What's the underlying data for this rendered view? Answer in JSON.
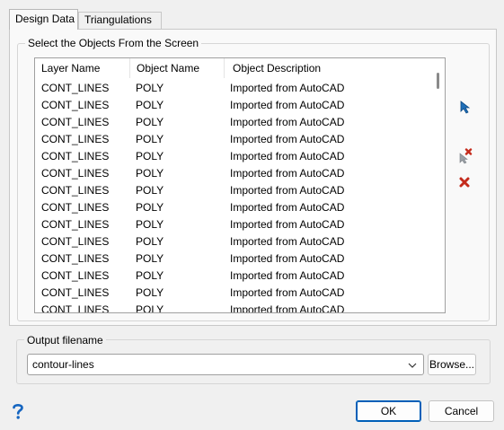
{
  "tabs": [
    {
      "label": "Design Data",
      "active": true
    },
    {
      "label": "Triangulations",
      "active": false
    }
  ],
  "objects_group": {
    "title": "Select the Objects From the Screen",
    "columns": [
      "Layer Name",
      "Object Name",
      "Object Description"
    ],
    "rows": [
      {
        "layer": "CONT_LINES",
        "object": "POLY",
        "description": "Imported from AutoCAD"
      },
      {
        "layer": "CONT_LINES",
        "object": "POLY",
        "description": "Imported from AutoCAD"
      },
      {
        "layer": "CONT_LINES",
        "object": "POLY",
        "description": "Imported from AutoCAD"
      },
      {
        "layer": "CONT_LINES",
        "object": "POLY",
        "description": "Imported from AutoCAD"
      },
      {
        "layer": "CONT_LINES",
        "object": "POLY",
        "description": "Imported from AutoCAD"
      },
      {
        "layer": "CONT_LINES",
        "object": "POLY",
        "description": "Imported from AutoCAD"
      },
      {
        "layer": "CONT_LINES",
        "object": "POLY",
        "description": "Imported from AutoCAD"
      },
      {
        "layer": "CONT_LINES",
        "object": "POLY",
        "description": "Imported from AutoCAD"
      },
      {
        "layer": "CONT_LINES",
        "object": "POLY",
        "description": "Imported from AutoCAD"
      },
      {
        "layer": "CONT_LINES",
        "object": "POLY",
        "description": "Imported from AutoCAD"
      },
      {
        "layer": "CONT_LINES",
        "object": "POLY",
        "description": "Imported from AutoCAD"
      },
      {
        "layer": "CONT_LINES",
        "object": "POLY",
        "description": "Imported from AutoCAD"
      },
      {
        "layer": "CONT_LINES",
        "object": "POLY",
        "description": "Imported from AutoCAD"
      },
      {
        "layer": "CONT_LINES",
        "object": "POLY",
        "description": "Imported from AutoCAD"
      }
    ],
    "side_icons": [
      "pick-arrow-icon",
      "unpick-arrow-icon",
      "delete-icon"
    ]
  },
  "output": {
    "title": "Output filename",
    "value": "contour-lines",
    "browse_label": "Browse..."
  },
  "footer": {
    "help_icon": "help-question-icon",
    "ok_label": "OK",
    "cancel_label": "Cancel"
  },
  "colors": {
    "accent": "#005fb8",
    "pick_icon": "#1f6fb8",
    "delete_icon": "#c42b1c"
  }
}
